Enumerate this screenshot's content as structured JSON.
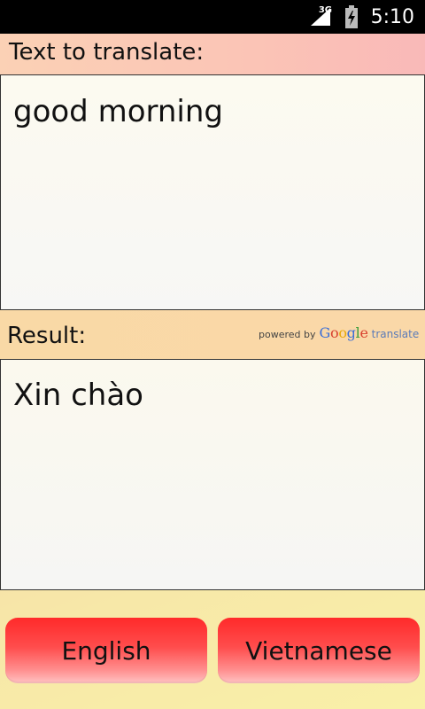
{
  "status_bar": {
    "network_type": "3G",
    "time": "5:10",
    "icons": [
      "signal-icon",
      "battery-charging-icon"
    ]
  },
  "translate_section": {
    "label": "Text to translate:",
    "input_value": "good morning"
  },
  "result_section": {
    "label": "Result:",
    "powered_by": "powered by",
    "google_letters": [
      "G",
      "o",
      "o",
      "g",
      "l",
      "e"
    ],
    "google_translate_word": "translate",
    "result_value": "Xin chào"
  },
  "buttons": {
    "source_language": "English",
    "target_language": "Vietnamese"
  },
  "colors": {
    "button_red": "#ff2a2a",
    "header_peach": "#fbc4b6",
    "background_yellow": "#f9f0a8"
  }
}
